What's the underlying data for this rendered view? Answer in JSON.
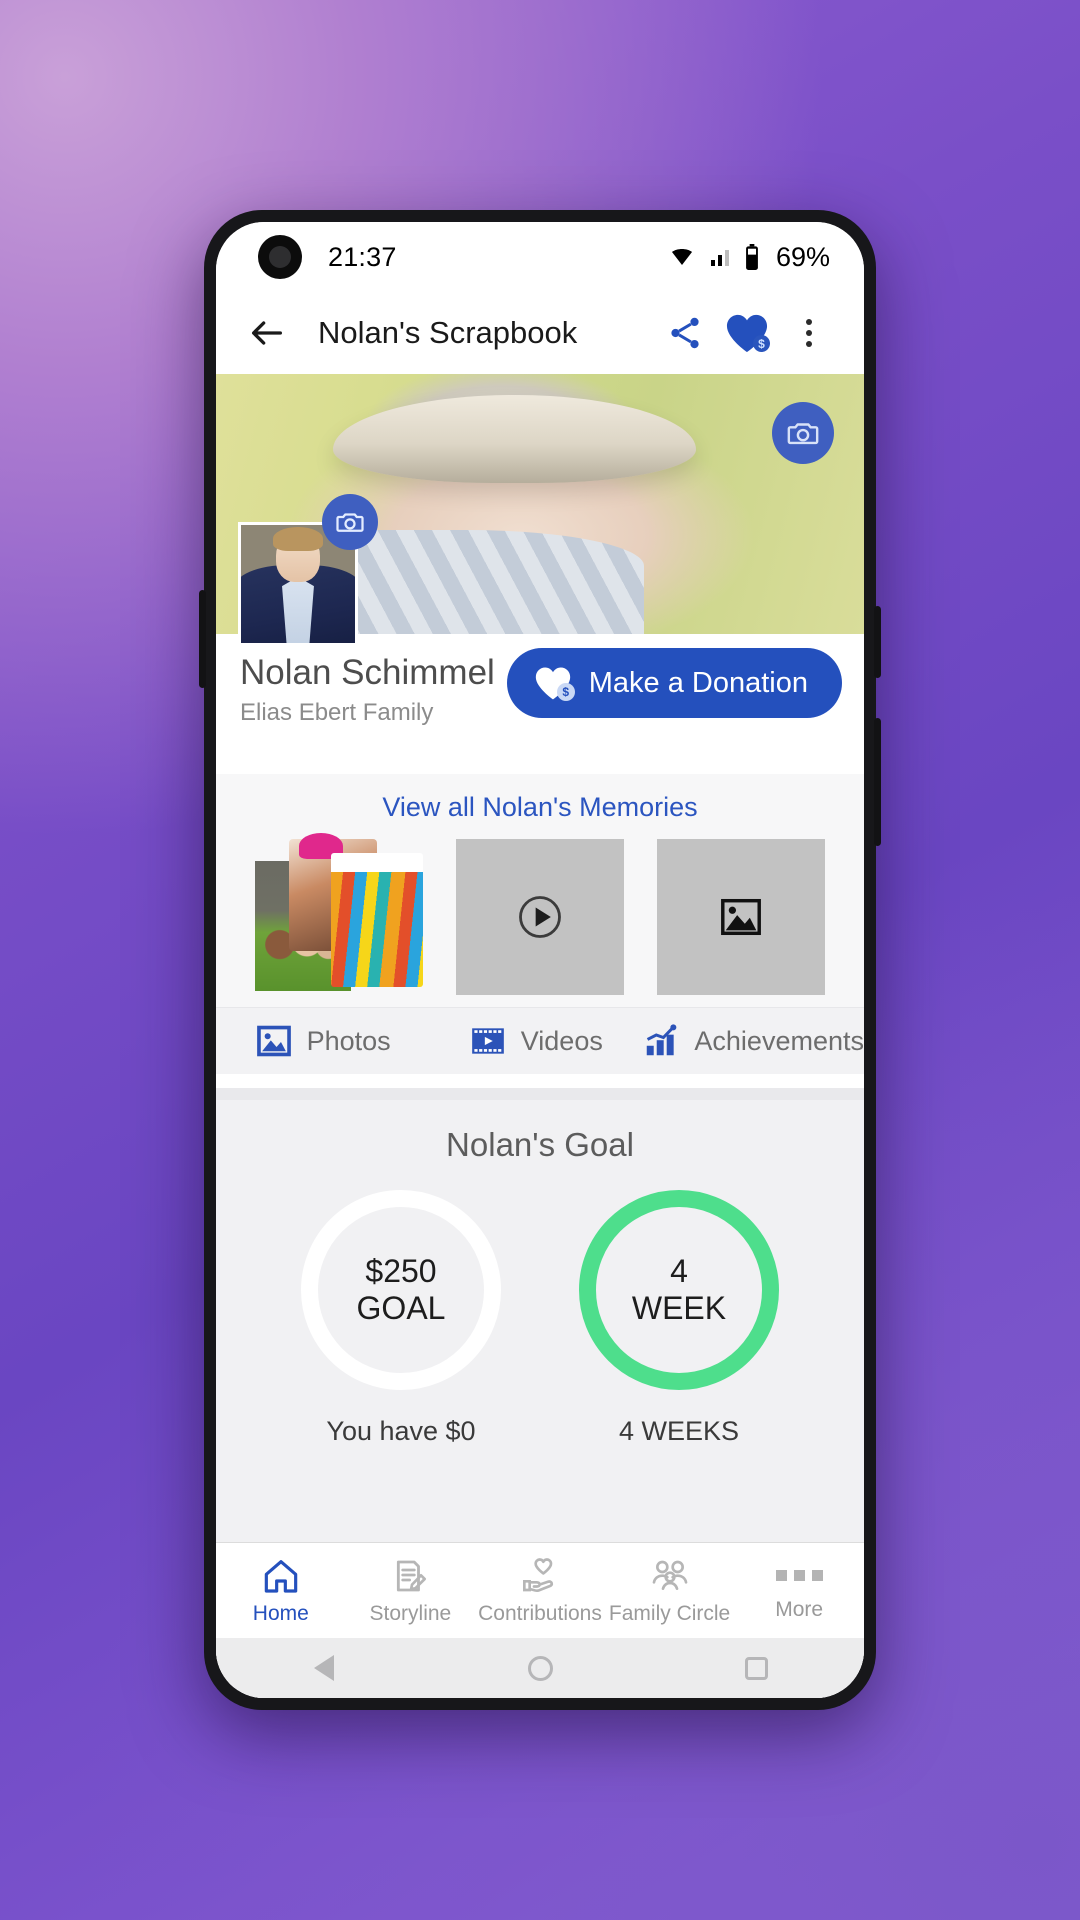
{
  "status_bar": {
    "time": "21:37",
    "battery_percent": "69%",
    "icons": [
      "wifi-icon",
      "cellular-signal-icon",
      "battery-icon"
    ]
  },
  "app_bar": {
    "back_icon": "back-arrow-icon",
    "title": "Nolan's Scrapbook",
    "share_icon": "share-icon",
    "donate_heart_icon": "heart-dollar-icon",
    "donate_heart_badge": "$",
    "overflow_icon": "more-vertical-icon"
  },
  "cover": {
    "camera_icon": "camera-icon",
    "avatar_camera_icon": "camera-icon"
  },
  "profile": {
    "name": "Nolan Schimmel",
    "family": "Elias Ebert Family",
    "donate_button_label": "Make a Donation",
    "donate_button_badge": "$",
    "donate_button_color": "#2450bd"
  },
  "memories": {
    "view_all_label": "View all Nolan's Memories",
    "link_color": "#2b55c0",
    "thumbnails": [
      {
        "name": "photo-collage-thumbnail",
        "type": "photo"
      },
      {
        "name": "video-thumbnail",
        "type": "video",
        "icon": "play-circle-icon"
      },
      {
        "name": "image-thumbnail",
        "type": "image",
        "icon": "image-placeholder-icon"
      }
    ],
    "tabs": [
      {
        "label": "Photos",
        "icon": "photo-icon"
      },
      {
        "label": "Videos",
        "icon": "video-icon"
      },
      {
        "label": "Achievements",
        "icon": "bar-chart-icon"
      }
    ]
  },
  "goal": {
    "title": "Nolan's Goal",
    "amount_ring": {
      "value": "$250",
      "unit": "GOAL",
      "caption": "You have $0",
      "ring_color": "#ffffff",
      "progress_percent": 0
    },
    "week_ring": {
      "value": "4",
      "unit": "WEEK",
      "caption": "4 WEEKS",
      "ring_color": "#4ede8c",
      "progress_percent": 100
    }
  },
  "bottom_nav": {
    "active_color": "#2450bd",
    "inactive_color": "#9a9a9a",
    "items": [
      {
        "label": "Home",
        "icon": "home-icon",
        "active": true
      },
      {
        "label": "Storyline",
        "icon": "note-edit-icon",
        "active": false
      },
      {
        "label": "Contributions",
        "icon": "hand-heart-icon",
        "active": false
      },
      {
        "label": "Family Circle",
        "icon": "people-group-icon",
        "active": false
      },
      {
        "label": "More",
        "icon": "more-dots-icon",
        "active": false
      }
    ]
  },
  "android_nav": {
    "back_icon": "android-back-icon",
    "home_icon": "android-home-icon",
    "recents_icon": "android-recents-icon"
  }
}
